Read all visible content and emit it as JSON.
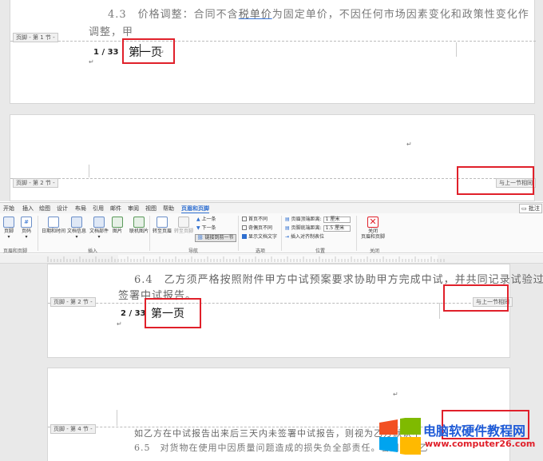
{
  "upper_view": {
    "text_line1": "4.3　价格调整：合同不含税单价为固定单价，不因任何市场因素变化和政策性变化作",
    "text_line1_link": "税单价",
    "text_line2": "调整，甲",
    "footer_tag_1": "页脚 - 第 1 节 -",
    "page_indicator": "1 / 33",
    "page_text": "第一页",
    "footer_tag_2": "页脚 - 第 2 节 -",
    "same_as_previous": "与上一节相同"
  },
  "ribbon": {
    "tabs": [
      "开始",
      "插入",
      "绘图",
      "设计",
      "布局",
      "引用",
      "邮件",
      "审阅",
      "视图",
      "帮助",
      "页眉和页脚"
    ],
    "active_tab": "页眉和页脚",
    "comment_button": "批注",
    "buttons": {
      "footer": "页脚",
      "page_number": "页码",
      "date_time": "日期和时间",
      "doc_info": "文档信息",
      "doc_parts": "文档部件",
      "picture": "图片",
      "online_picture": "联机图片",
      "go_to_header": "转至页眉",
      "go_to_footer": "转至页脚",
      "previous": "上一条",
      "next": "下一条",
      "link_to_previous": "链接到前一节",
      "different_first_page": "首页不同",
      "different_odd_even": "奇偶页不同",
      "show_document_text": "显示文档文字",
      "header_from_top": "页眉顶端距离:",
      "header_from_top_value": "1 厘米",
      "footer_from_bottom": "页脚底端距离:",
      "footer_from_bottom_value": "1.5 厘米",
      "insert_alignment_tab": "插入对齐制表位",
      "close_label_1": "关闭",
      "close_label_2": "页眉和页脚"
    },
    "groups": [
      "页眉和页脚",
      "插入",
      "导航",
      "选项",
      "位置",
      "关闭"
    ]
  },
  "lower_view": {
    "text_line1": "6.4　乙方须严格按照附件甲方中试预案要求协助甲方完成中试，并共同记录试验过程，",
    "text_line2": "签署中试报告。",
    "footer_tag_2": "页脚 - 第 2 节 -",
    "same_as_previous": "与上一节相同",
    "page_indicator": "2 / 33",
    "page_text": "第一页",
    "footer_tag_4": "页脚 - 第 4 节 -",
    "text_line3": "如乙方在中试报告出来后三天内未签署中试报告，则视为乙方默认中",
    "text_line4": "6.5　对货物在使用中因质量问题造成的损失负全部责任。若因使用乙"
  },
  "watermark": {
    "title": "电脑软硬件教程网",
    "url": "www.computer26.com"
  },
  "colors": {
    "highlight_box": "#e0202a",
    "active_tab": "#2f6fd0",
    "watermark": "#1e5bd8"
  }
}
